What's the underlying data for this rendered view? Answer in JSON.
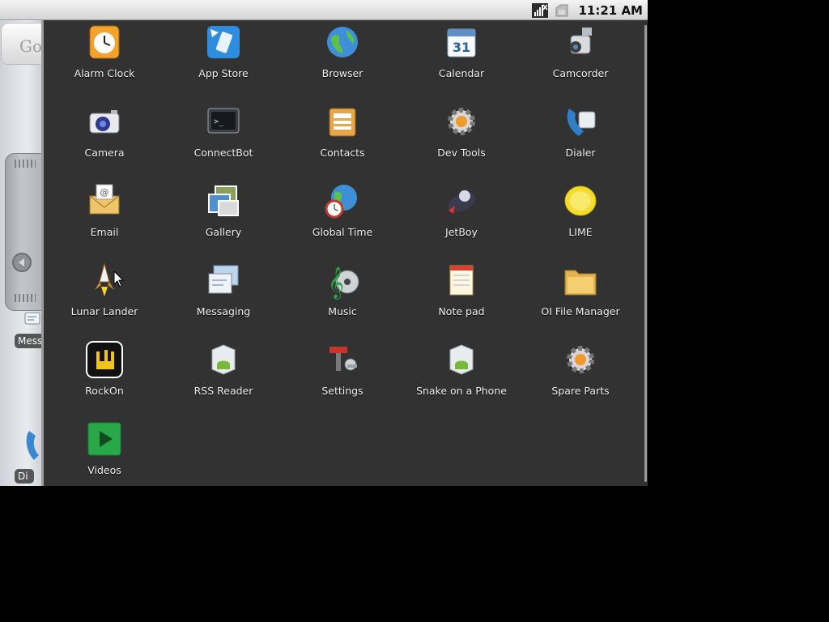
{
  "status_bar": {
    "time": "11:21 AM",
    "icons": [
      "signal-icon",
      "no-sim-icon",
      "usb-icon"
    ]
  },
  "home_screen": {
    "search_widget_text": "Go",
    "shortcut_labels": [
      "Mess",
      "Di"
    ]
  },
  "apps": [
    {
      "label": "Alarm Clock",
      "icon": "alarm-clock-icon"
    },
    {
      "label": "App Store",
      "icon": "app-store-icon"
    },
    {
      "label": "Browser",
      "icon": "browser-icon"
    },
    {
      "label": "Calendar",
      "icon": "calendar-icon"
    },
    {
      "label": "Camcorder",
      "icon": "camcorder-icon"
    },
    {
      "label": "Camera",
      "icon": "camera-icon"
    },
    {
      "label": "ConnectBot",
      "icon": "connectbot-icon"
    },
    {
      "label": "Contacts",
      "icon": "contacts-icon"
    },
    {
      "label": "Dev Tools",
      "icon": "dev-tools-icon"
    },
    {
      "label": "Dialer",
      "icon": "dialer-icon"
    },
    {
      "label": "Email",
      "icon": "email-icon"
    },
    {
      "label": "Gallery",
      "icon": "gallery-icon"
    },
    {
      "label": "Global Time",
      "icon": "global-time-icon"
    },
    {
      "label": "JetBoy",
      "icon": "jetboy-icon"
    },
    {
      "label": "LIME",
      "icon": "lime-icon"
    },
    {
      "label": "Lunar Lander",
      "icon": "lunar-lander-icon"
    },
    {
      "label": "Messaging",
      "icon": "messaging-icon"
    },
    {
      "label": "Music",
      "icon": "music-icon"
    },
    {
      "label": "Note pad",
      "icon": "notepad-icon"
    },
    {
      "label": "OI File Manager",
      "icon": "file-manager-icon"
    },
    {
      "label": "RockOn",
      "icon": "rockon-icon"
    },
    {
      "label": "RSS Reader",
      "icon": "rss-reader-icon"
    },
    {
      "label": "Settings",
      "icon": "settings-icon"
    },
    {
      "label": "Snake on a Phone",
      "icon": "snake-icon"
    },
    {
      "label": "Spare Parts",
      "icon": "spare-parts-icon"
    },
    {
      "label": "Videos",
      "icon": "videos-icon"
    }
  ]
}
